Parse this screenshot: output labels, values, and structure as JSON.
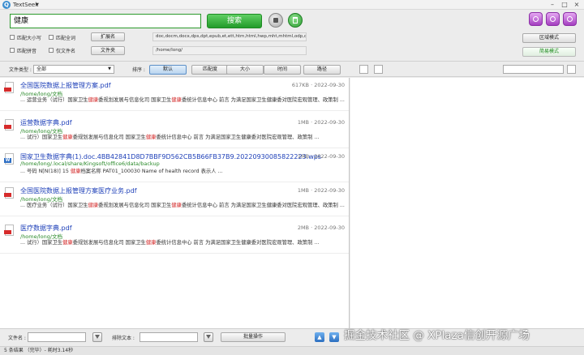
{
  "window": {
    "title": "TextSeek",
    "menu_arrow": "▼",
    "minimize": "–",
    "maximize": "□",
    "close": "×"
  },
  "search": {
    "query": "健康",
    "button": "搜索"
  },
  "options": {
    "match_case": "匹配大小写",
    "match_whole": "匹配全词",
    "match_pinyin": "匹配拼音",
    "filename_only": "仅文件名",
    "extensions_button": "扩展名",
    "extensions_value": "doc,docm,docx,dps,dpt,epub,et,ett,htm,html,hwp,mht,mhtml,odp,ods,odt,ofd,pdf,ppt,",
    "folder_button": "文件夹",
    "folder_value": "/home/long/"
  },
  "modes": {
    "area_mode": "区域模式",
    "simple_mode": "简易模式"
  },
  "toolbar": {
    "filetype_label": "文件类型 :",
    "filetype_value": "全部",
    "sort_label": "排序 :",
    "sort_buttons": [
      "默认",
      "匹配度",
      "大小",
      "时间",
      "路径"
    ]
  },
  "results": [
    {
      "title": "全国医院数据上报管理方案.pdf",
      "meta": "617KB · 2022-09-30",
      "path": "/home/long/文档",
      "snippet_pre": "... 运营业务（试行）国家卫生",
      "hl": "健康",
      "snippet_mid": "委规划发展与信息化司 国家卫生",
      "snippet_post": "委统计信息中心 前言 为满足国家卫生健康委对医院宏观管理、政策制 ...",
      "icon": "pdf-icon"
    },
    {
      "title": "运营数据字典.pdf",
      "meta": "1MB · 2022-09-30",
      "path": "/home/long/文档",
      "snippet_pre": "... 试行）国家卫生",
      "hl": "健康",
      "snippet_mid": "委规划发展与信息化司 国家卫生",
      "snippet_post": "委统计信息中心 前言 为满足国家卫生健康委对医院宏观管理、政策制 ...",
      "icon": "pdf-icon"
    },
    {
      "title": "国家卫生数据字典(1).doc.4BB42841D8D7BBF9D562CB5B66FB37B9.20220930085822223.wps",
      "meta": "1MB · 2022-09-30",
      "path": "/home/long/.local/share/Kingsoft/office6/data/backup",
      "snippet_pre": "... 号码 N[N(18)] 15 ",
      "hl": "健康",
      "snippet_mid": "档案名称 PAT01_100030 Name of health record 表示人 ...",
      "snippet_post": "",
      "icon": "wps-icon"
    },
    {
      "title": "全国医院数据上报管理方案医疗业务.pdf",
      "meta": "1MB · 2022-09-30",
      "path": "/home/long/文档",
      "snippet_pre": "... 医疗业务（试行）国家卫生",
      "hl": "健康",
      "snippet_mid": "委规划发展与信息化司 国家卫生",
      "snippet_post": "委统计信息中心 前言 为满足国家卫生健康委对医院宏观管理、政策制 ...",
      "icon": "pdf-icon"
    },
    {
      "title": "医疗数据字典.pdf",
      "meta": "2MB · 2022-09-30",
      "path": "/home/long/文档",
      "snippet_pre": "... 试行）国家卫生",
      "hl": "健康",
      "snippet_mid": "委规划发展与信息化司 国家卫生",
      "snippet_post": "委统计信息中心 前言 为满足国家卫生健康委对医院宏观管理、政策制 ...",
      "icon": "pdf-icon"
    }
  ],
  "bottom": {
    "filename_label": "文件名 :",
    "exclude_label": "排除文本 :",
    "batch_button": "批量操作",
    "up_arrow": "▲",
    "down_arrow": "▼"
  },
  "status": {
    "text": "5 条结果 （完毕）- 耗时3.14秒"
  },
  "watermark": "掘金技术社区 @ XPlaza信创开源广场"
}
